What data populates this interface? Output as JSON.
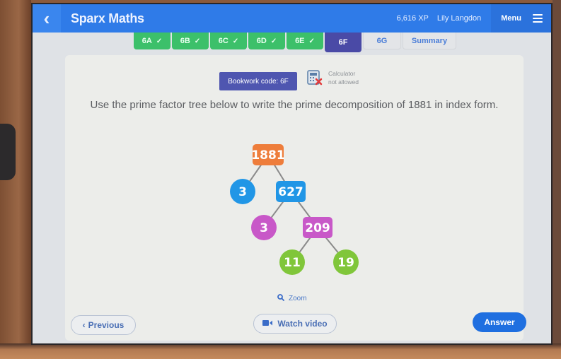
{
  "header": {
    "back_icon": "chevron-left-icon",
    "title": "Sparx Maths",
    "xp": "6,616 XP",
    "user_name": "Lily Langdon",
    "menu_label": "Menu",
    "menu_icon": "hamburger-icon"
  },
  "tabs": [
    {
      "label": "6A",
      "state": "complete",
      "check": "✓"
    },
    {
      "label": "6B",
      "state": "complete",
      "check": "✓"
    },
    {
      "label": "6C",
      "state": "complete",
      "check": "✓"
    },
    {
      "label": "6D",
      "state": "complete",
      "check": "✓"
    },
    {
      "label": "6E",
      "state": "complete",
      "check": "✓"
    },
    {
      "label": "6F",
      "state": "current"
    },
    {
      "label": "6G",
      "state": "future"
    },
    {
      "label": "Summary",
      "state": "future"
    }
  ],
  "question": {
    "bookwork_code": "Bookwork code: 6F",
    "calculator_line1": "Calculator",
    "calculator_line2": "not allowed",
    "text": "Use the prime factor tree below to write the prime decomposition of 1881 in index form."
  },
  "factor_tree": {
    "nodes": [
      {
        "id": "n1881",
        "value": "1881",
        "shape": "box",
        "color": "#ee7d3b"
      },
      {
        "id": "n3a",
        "value": "3",
        "shape": "circle",
        "color": "#2196e6"
      },
      {
        "id": "n627",
        "value": "627",
        "shape": "box",
        "color": "#2196e6"
      },
      {
        "id": "n3b",
        "value": "3",
        "shape": "circle",
        "color": "#c858c8"
      },
      {
        "id": "n209",
        "value": "209",
        "shape": "box",
        "color": "#c858c8"
      },
      {
        "id": "n11",
        "value": "11",
        "shape": "circle",
        "color": "#80c63a"
      },
      {
        "id": "n19",
        "value": "19",
        "shape": "circle",
        "color": "#80c63a"
      }
    ],
    "edges": [
      [
        "n1881",
        "n3a"
      ],
      [
        "n1881",
        "n627"
      ],
      [
        "n627",
        "n3b"
      ],
      [
        "n627",
        "n209"
      ],
      [
        "n209",
        "n11"
      ],
      [
        "n209",
        "n19"
      ]
    ]
  },
  "footer": {
    "zoom_label": "Zoom",
    "previous_label": "Previous",
    "watch_video_label": "Watch video",
    "answer_label": "Answer"
  },
  "colors": {
    "header_blue": "#2f7be8",
    "tab_complete": "#3cc06a",
    "tab_current": "#4a4aa6",
    "answer_blue": "#1f6fe0"
  }
}
